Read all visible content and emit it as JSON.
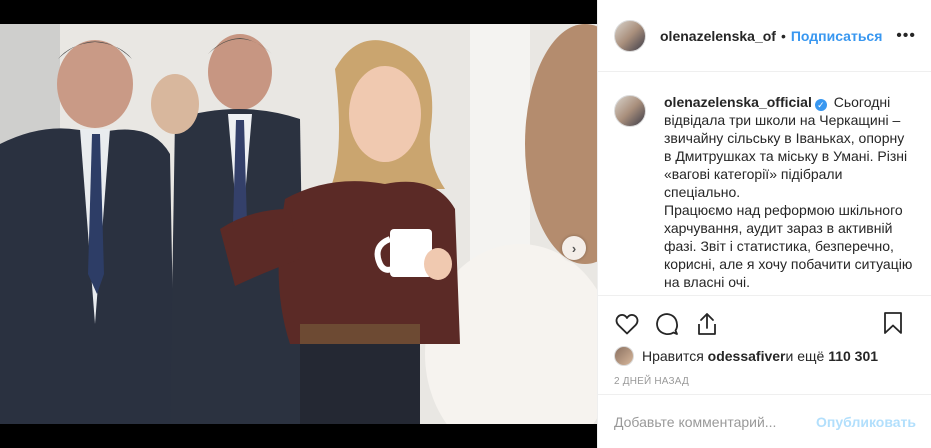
{
  "post": {
    "username_header": "olenazelenska_of",
    "separator": "•",
    "follow_label": "Подписаться",
    "more_label": "•••",
    "caption_username": "olenazelenska_official",
    "verified_mark": "✓",
    "caption_lines": [
      "Сьогодні відвідала три школи на Черкащині – звичайну сільську в Іваньках, опорну в Дмитрушках та міську в Умані. Різні «вагові категорії» підібрали спеціально.",
      "Працюємо над реформою шкільного харчування, аудит зараз в активній фазі. Звіт і статистика, безперечно, корисні, але я хочу побачити ситуацію на власні очі."
    ],
    "likes_prefix": "Нравится ",
    "likes_user": "odessafiver",
    "likes_middle": " и ещё ",
    "likes_count": "110 301",
    "date": "2 ДНЕЙ НАЗАД",
    "comment_placeholder": "Добавьте комментарий...",
    "publish_label": "Опубликовать",
    "next_arrow": "›",
    "carousel": {
      "slides": 5,
      "active_index": 0
    }
  },
  "colors": {
    "accent": "#3897f0",
    "publish_disabled": "#b2dffc",
    "text": "#262626",
    "muted": "#999999"
  },
  "icons": [
    "heart-icon",
    "comment-icon",
    "share-icon",
    "bookmark-icon",
    "verified-icon",
    "chevron-right-icon"
  ]
}
